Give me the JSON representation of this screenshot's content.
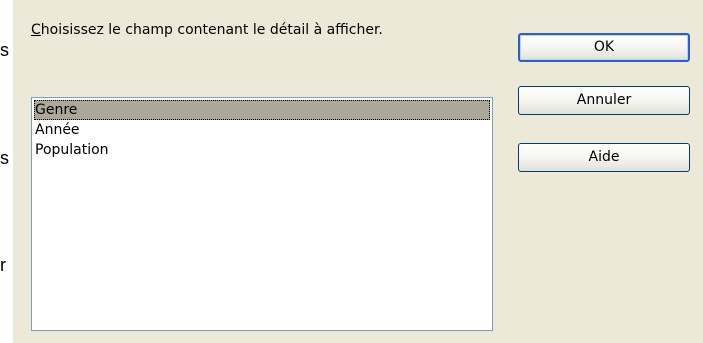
{
  "background_letters": [
    "s",
    "s",
    "r"
  ],
  "dialog": {
    "prompt_mnemonic": "C",
    "prompt_rest": "hoisissez le champ contenant le détail à afficher.",
    "list_items": [
      {
        "label": "Genre",
        "selected": true
      },
      {
        "label": "Année",
        "selected": false
      },
      {
        "label": "Population",
        "selected": false
      }
    ],
    "buttons": {
      "ok": "OK",
      "cancel": "Annuler",
      "help": "Aide"
    }
  },
  "colors": {
    "dialog_background": "#ece9d8",
    "selection_background": "#aca899",
    "listbox_border": "#7f9db9",
    "button_border": "#003c74",
    "default_button_border": "#2f5ec8"
  }
}
